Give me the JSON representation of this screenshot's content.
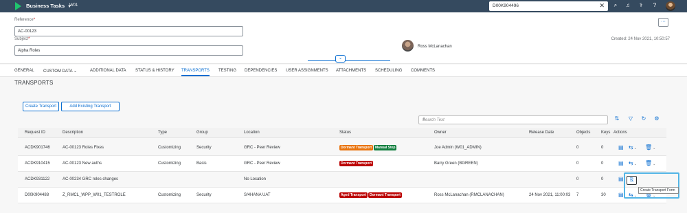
{
  "shell": {
    "app_title": "Business Tasks",
    "system_id": "W01",
    "search_value": "D00K904496",
    "colors": {
      "shell_bg": "#354a5f",
      "logo": "#1fc46e"
    }
  },
  "header": {
    "reference_label": "Reference",
    "reference_value": "AC-00123",
    "subject_label": "Subject",
    "subject_value": "Alpha Roles",
    "required_mark": "*",
    "owner_name": "Ross McLanachan",
    "created": "Created: 24 Nov 2021, 10:50:57"
  },
  "tabs": [
    {
      "label": "GENERAL"
    },
    {
      "label": "CUSTOM DATA"
    },
    {
      "label": "ADDITIONAL DATA"
    },
    {
      "label": "STATUS & HISTORY"
    },
    {
      "label": "TRANSPORTS"
    },
    {
      "label": "TESTING"
    },
    {
      "label": "DEPENDENCIES"
    },
    {
      "label": "USER ASSIGNMENTS"
    },
    {
      "label": "ATTACHMENTS"
    },
    {
      "label": "SCHEDULING"
    },
    {
      "label": "COMMENTS"
    }
  ],
  "transports": {
    "title": "TRANSPORTS",
    "create_btn": "Create Transport",
    "add_existing_btn": "Add Existing Transport",
    "search_placeholder": "Search Text",
    "columns": [
      "Request ID",
      "Description",
      "Type",
      "Group",
      "Location",
      "Status",
      "Owner",
      "Release Date",
      "Objects",
      "Keys",
      "Actions"
    ],
    "rows": [
      {
        "id": "ACDK901746",
        "desc": "AC-00123 Roles Fixes",
        "type": "Customizing",
        "group": "Security",
        "location": "GRC - Peer Review",
        "status1": "Dormant Transport",
        "status2": "Manual Step",
        "owner": "Joe Admin (W01_ADMIN)",
        "release": "",
        "objects": "0",
        "keys": "0"
      },
      {
        "id": "ACDK910415",
        "desc": "AC-00123 New auths",
        "type": "Customizing",
        "group": "Basis",
        "location": "GRC - Peer Review",
        "status1": "Dormant Transport",
        "status2": "",
        "owner": "Barry Green (BGREEN)",
        "release": "",
        "objects": "0",
        "keys": "0"
      },
      {
        "id": "ACDK931122",
        "desc": "AC-00234 GRC roles changes",
        "type": "",
        "group": "",
        "location": "No Location",
        "status1": "",
        "status2": "",
        "owner": "",
        "release": "",
        "objects": "0",
        "keys": "0"
      },
      {
        "id": "D00K904488",
        "desc": "Z_RMCL_WPP_W01_TESTROLE",
        "type": "Customizing",
        "group": "Security",
        "location": "S/4HANA UAT",
        "status1": "Aged Transport",
        "status2": "Dormant Transport",
        "owner": "Ross McLanachan (RMCLANACHAN)",
        "release": "24 Nov 2021, 11:00:03",
        "objects": "7",
        "keys": "30"
      }
    ],
    "tooltip": "Create Transport Form",
    "badge_colors": {
      "dormant": "#bb0000",
      "manual": "#107e3e",
      "aged_first": "#e9730c"
    }
  }
}
